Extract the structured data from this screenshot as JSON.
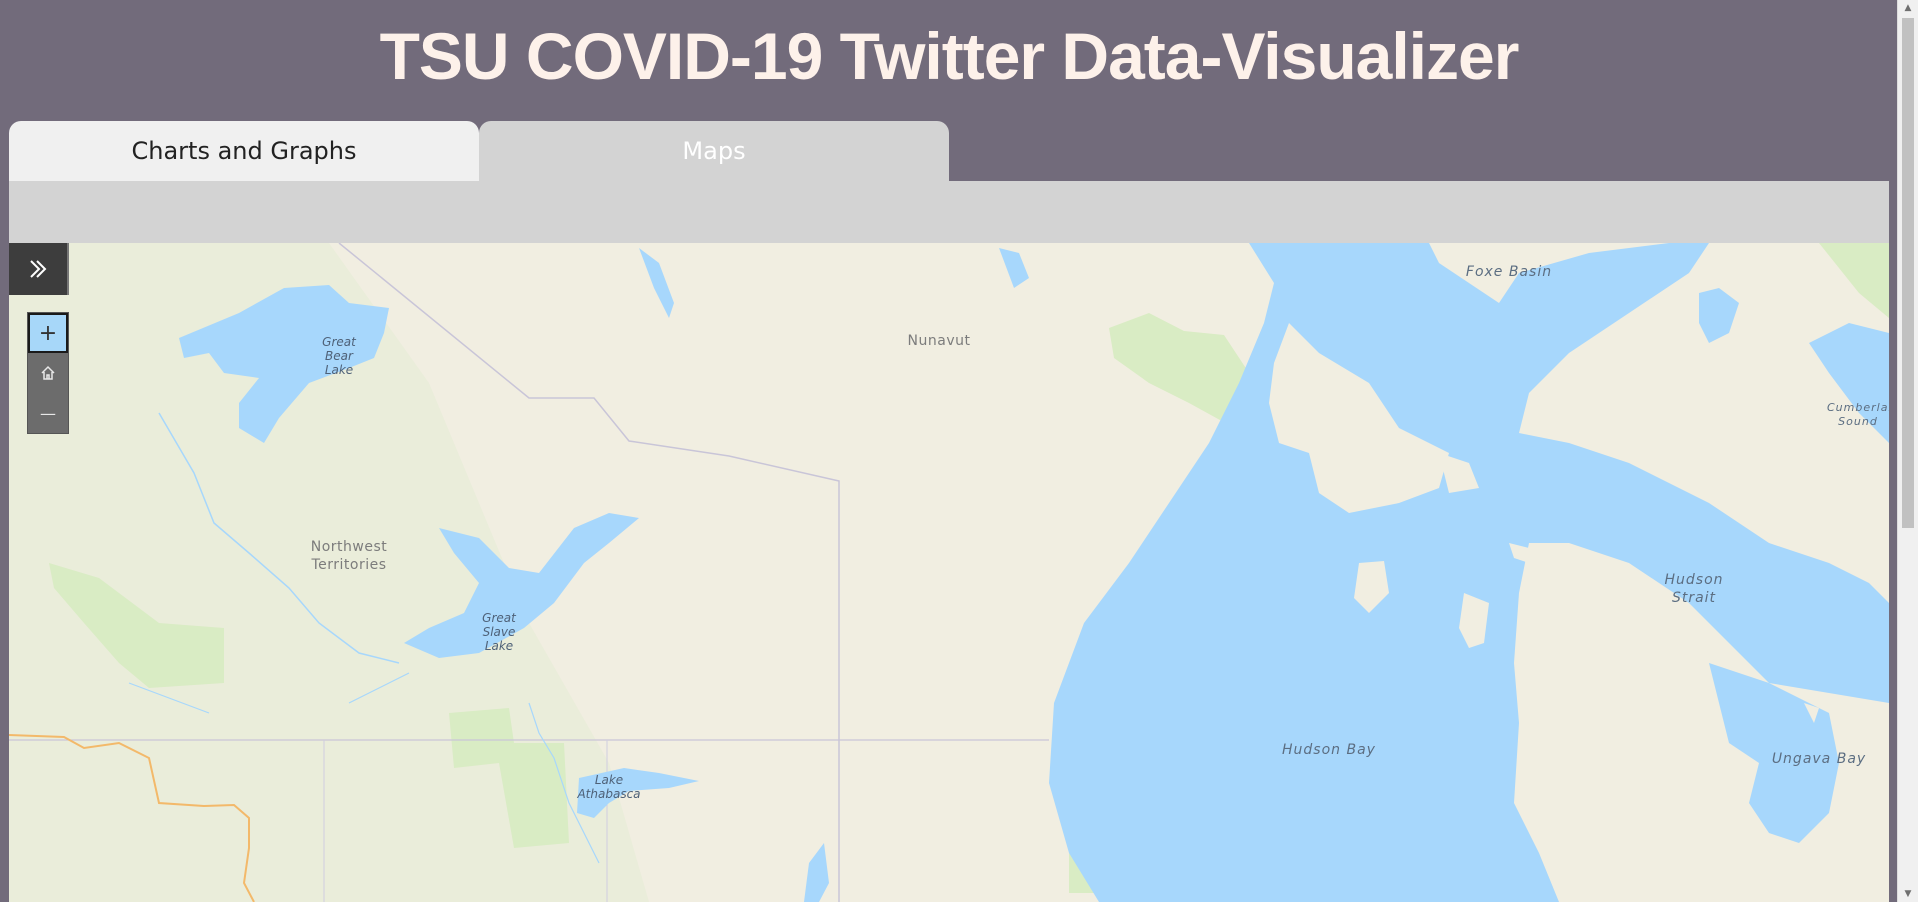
{
  "app": {
    "title": "TSU COVID-19 Twitter Data-Visualizer"
  },
  "tabs": [
    {
      "label": "Charts and Graphs"
    },
    {
      "label": "Maps"
    }
  ],
  "map": {
    "place_labels": {
      "nunavut": "Nunavut",
      "northwest_territories": "Northwest Territories"
    },
    "water_labels": {
      "foxe_basin": "Foxe Basin",
      "hudson_bay": "Hudson Bay",
      "hudson_strait": "Hudson Strait",
      "ungava_bay": "Ungava Bay",
      "cumberland_sound": "Cumberland Sound"
    },
    "lake_labels": {
      "great_bear_lake": "Great Bear Lake",
      "great_slave_lake": "Great Slave Lake",
      "lake_athabasca": "Lake Athabasca"
    },
    "controls": {
      "expand_icon": "double-chevron-right-icon",
      "zoom_in_glyph": "+",
      "home_icon": "home-icon",
      "zoom_out_glyph": "—"
    },
    "colors": {
      "land": "#f1eee1",
      "water": "#a7d7fc",
      "park": "#d9ecc4",
      "border": "#c9c5d8",
      "highway": "#f3b96a"
    }
  },
  "theme": {
    "page_bg": "#726b7b",
    "title_color": "#fdf1ea",
    "active_tab_bg": "#f0f0f0",
    "inactive_tab_bg": "#d3d3d3"
  }
}
